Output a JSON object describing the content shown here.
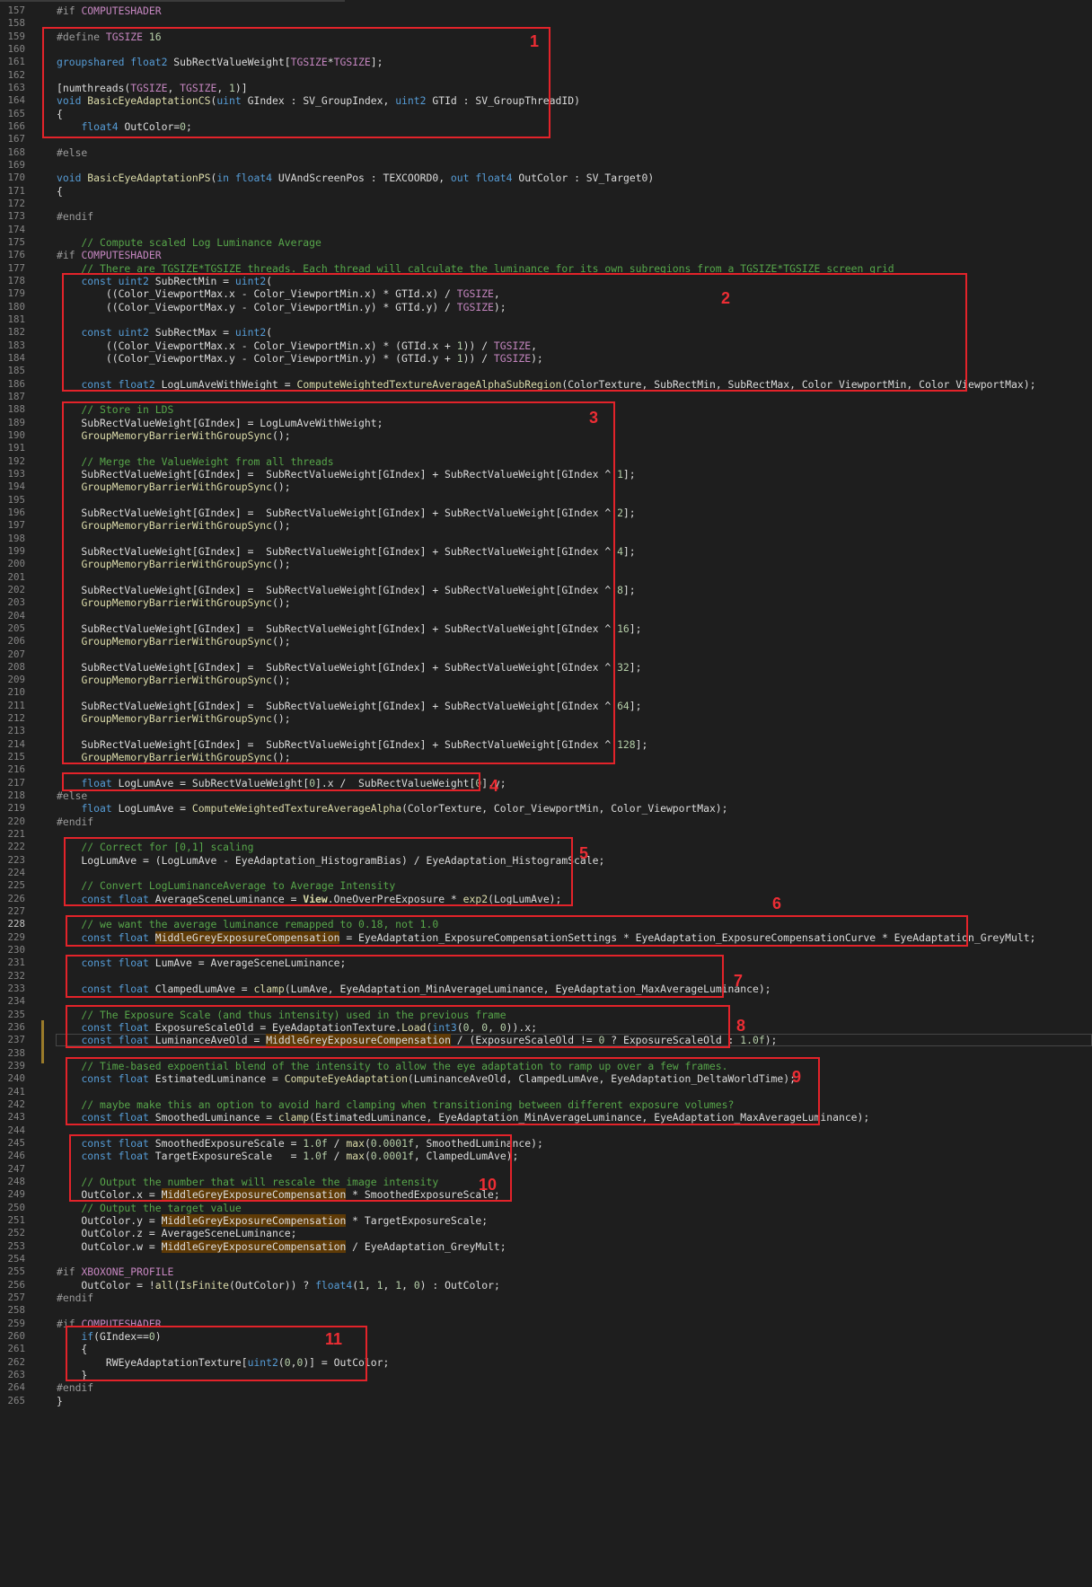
{
  "lines": [
    {
      "n": "157",
      "t": "#if COMPUTESHADER"
    },
    {
      "n": "158",
      "t": ""
    },
    {
      "n": "159",
      "t": "#define TGSIZE 16"
    },
    {
      "n": "160",
      "t": ""
    },
    {
      "n": "161",
      "t": "groupshared float2 SubRectValueWeight[TGSIZE*TGSIZE];"
    },
    {
      "n": "162",
      "t": ""
    },
    {
      "n": "163",
      "t": "[numthreads(TGSIZE, TGSIZE, 1)]"
    },
    {
      "n": "164",
      "t": "void BasicEyeAdaptationCS(uint GIndex : SV_GroupIndex, uint2 GTId : SV_GroupThreadID)"
    },
    {
      "n": "165",
      "t": "{"
    },
    {
      "n": "166",
      "t": "    float4 OutColor=0;"
    },
    {
      "n": "167",
      "t": ""
    },
    {
      "n": "168",
      "t": "#else"
    },
    {
      "n": "169",
      "t": ""
    },
    {
      "n": "170",
      "t": "void BasicEyeAdaptationPS(in float4 UVAndScreenPos : TEXCOORD0, out float4 OutColor : SV_Target0)"
    },
    {
      "n": "171",
      "t": "{"
    },
    {
      "n": "172",
      "t": ""
    },
    {
      "n": "173",
      "t": "#endif"
    },
    {
      "n": "174",
      "t": ""
    },
    {
      "n": "175",
      "t": "    // Compute scaled Log Luminance Average"
    },
    {
      "n": "176",
      "t": "#if COMPUTESHADER"
    },
    {
      "n": "177",
      "t": "    // There are TGSIZE*TGSIZE threads. Each thread will calculate the luminance for its own subregions from a TGSIZE*TGSIZE screen grid"
    },
    {
      "n": "178",
      "t": "    const uint2 SubRectMin = uint2("
    },
    {
      "n": "179",
      "t": "        ((Color_ViewportMax.x - Color_ViewportMin.x) * GTId.x) / TGSIZE,"
    },
    {
      "n": "180",
      "t": "        ((Color_ViewportMax.y - Color_ViewportMin.y) * GTId.y) / TGSIZE);"
    },
    {
      "n": "181",
      "t": ""
    },
    {
      "n": "182",
      "t": "    const uint2 SubRectMax = uint2("
    },
    {
      "n": "183",
      "t": "        ((Color_ViewportMax.x - Color_ViewportMin.x) * (GTId.x + 1)) / TGSIZE,"
    },
    {
      "n": "184",
      "t": "        ((Color_ViewportMax.y - Color_ViewportMin.y) * (GTId.y + 1)) / TGSIZE);"
    },
    {
      "n": "185",
      "t": ""
    },
    {
      "n": "186",
      "t": "    const float2 LogLumAveWithWeight = ComputeWeightedTextureAverageAlphaSubRegion(ColorTexture, SubRectMin, SubRectMax, Color_ViewportMin, Color_ViewportMax);"
    },
    {
      "n": "187",
      "t": ""
    },
    {
      "n": "188",
      "t": "    // Store in LDS"
    },
    {
      "n": "189",
      "t": "    SubRectValueWeight[GIndex] = LogLumAveWithWeight;"
    },
    {
      "n": "190",
      "t": "    GroupMemoryBarrierWithGroupSync();"
    },
    {
      "n": "191",
      "t": ""
    },
    {
      "n": "192",
      "t": "    // Merge the ValueWeight from all threads"
    },
    {
      "n": "193",
      "t": "    SubRectValueWeight[GIndex] =  SubRectValueWeight[GIndex] + SubRectValueWeight[GIndex ^ 1];"
    },
    {
      "n": "194",
      "t": "    GroupMemoryBarrierWithGroupSync();"
    },
    {
      "n": "195",
      "t": ""
    },
    {
      "n": "196",
      "t": "    SubRectValueWeight[GIndex] =  SubRectValueWeight[GIndex] + SubRectValueWeight[GIndex ^ 2];"
    },
    {
      "n": "197",
      "t": "    GroupMemoryBarrierWithGroupSync();"
    },
    {
      "n": "198",
      "t": ""
    },
    {
      "n": "199",
      "t": "    SubRectValueWeight[GIndex] =  SubRectValueWeight[GIndex] + SubRectValueWeight[GIndex ^ 4];"
    },
    {
      "n": "200",
      "t": "    GroupMemoryBarrierWithGroupSync();"
    },
    {
      "n": "201",
      "t": ""
    },
    {
      "n": "202",
      "t": "    SubRectValueWeight[GIndex] =  SubRectValueWeight[GIndex] + SubRectValueWeight[GIndex ^ 8];"
    },
    {
      "n": "203",
      "t": "    GroupMemoryBarrierWithGroupSync();"
    },
    {
      "n": "204",
      "t": ""
    },
    {
      "n": "205",
      "t": "    SubRectValueWeight[GIndex] =  SubRectValueWeight[GIndex] + SubRectValueWeight[GIndex ^ 16];"
    },
    {
      "n": "206",
      "t": "    GroupMemoryBarrierWithGroupSync();"
    },
    {
      "n": "207",
      "t": ""
    },
    {
      "n": "208",
      "t": "    SubRectValueWeight[GIndex] =  SubRectValueWeight[GIndex] + SubRectValueWeight[GIndex ^ 32];"
    },
    {
      "n": "209",
      "t": "    GroupMemoryBarrierWithGroupSync();"
    },
    {
      "n": "210",
      "t": ""
    },
    {
      "n": "211",
      "t": "    SubRectValueWeight[GIndex] =  SubRectValueWeight[GIndex] + SubRectValueWeight[GIndex ^ 64];"
    },
    {
      "n": "212",
      "t": "    GroupMemoryBarrierWithGroupSync();"
    },
    {
      "n": "213",
      "t": ""
    },
    {
      "n": "214",
      "t": "    SubRectValueWeight[GIndex] =  SubRectValueWeight[GIndex] + SubRectValueWeight[GIndex ^ 128];"
    },
    {
      "n": "215",
      "t": "    GroupMemoryBarrierWithGroupSync();"
    },
    {
      "n": "216",
      "t": ""
    },
    {
      "n": "217",
      "t": "    float LogLumAve = SubRectValueWeight[0].x /  SubRectValueWeight[0].y;"
    },
    {
      "n": "218",
      "t": "#else"
    },
    {
      "n": "219",
      "t": "    float LogLumAve = ComputeWeightedTextureAverageAlpha(ColorTexture, Color_ViewportMin, Color_ViewportMax);"
    },
    {
      "n": "220",
      "t": "#endif"
    },
    {
      "n": "221",
      "t": ""
    },
    {
      "n": "222",
      "t": "    // Correct for [0,1] scaling"
    },
    {
      "n": "223",
      "t": "    LogLumAve = (LogLumAve - EyeAdaptation_HistogramBias) / EyeAdaptation_HistogramScale;"
    },
    {
      "n": "224",
      "t": ""
    },
    {
      "n": "225",
      "t": "    // Convert LogLuminanceAverage to Average Intensity"
    },
    {
      "n": "226",
      "t": "    const float AverageSceneLuminance = View.OneOverPreExposure * exp2(LogLumAve);"
    },
    {
      "n": "227",
      "t": ""
    },
    {
      "n": "228",
      "t": "    // we want the average luminance remapped to 0.18, not 1.0"
    },
    {
      "n": "229",
      "t": "    const float MiddleGreyExposureCompensation = EyeAdaptation_ExposureCompensationSettings * EyeAdaptation_ExposureCompensationCurve * EyeAdaptation_GreyMult;"
    },
    {
      "n": "230",
      "t": ""
    },
    {
      "n": "231",
      "t": "    const float LumAve = AverageSceneLuminance;"
    },
    {
      "n": "232",
      "t": ""
    },
    {
      "n": "233",
      "t": "    const float ClampedLumAve = clamp(LumAve, EyeAdaptation_MinAverageLuminance, EyeAdaptation_MaxAverageLuminance);"
    },
    {
      "n": "234",
      "t": ""
    },
    {
      "n": "235",
      "t": "    // The Exposure Scale (and thus intensity) used in the previous frame"
    },
    {
      "n": "236",
      "t": "    const float ExposureScaleOld = EyeAdaptationTexture.Load(int3(0, 0, 0)).x;"
    },
    {
      "n": "237",
      "t": "    const float LuminanceAveOld = MiddleGreyExposureCompensation / (ExposureScaleOld != 0 ? ExposureScaleOld : 1.0f);"
    },
    {
      "n": "238",
      "t": ""
    },
    {
      "n": "239",
      "t": "    // Time-based expoential blend of the intensity to allow the eye adaptation to ramp up over a few frames."
    },
    {
      "n": "240",
      "t": "    const float EstimatedLuminance = ComputeEyeAdaptation(LuminanceAveOld, ClampedLumAve, EyeAdaptation_DeltaWorldTime);"
    },
    {
      "n": "241",
      "t": ""
    },
    {
      "n": "242",
      "t": "    // maybe make this an option to avoid hard clamping when transitioning between different exposure volumes?"
    },
    {
      "n": "243",
      "t": "    const float SmoothedLuminance = clamp(EstimatedLuminance, EyeAdaptation_MinAverageLuminance, EyeAdaptation_MaxAverageLuminance);"
    },
    {
      "n": "244",
      "t": ""
    },
    {
      "n": "245",
      "t": "    const float SmoothedExposureScale = 1.0f / max(0.0001f, SmoothedLuminance);"
    },
    {
      "n": "246",
      "t": "    const float TargetExposureScale   = 1.0f / max(0.0001f, ClampedLumAve);"
    },
    {
      "n": "247",
      "t": ""
    },
    {
      "n": "248",
      "t": "    // Output the number that will rescale the image intensity"
    },
    {
      "n": "249",
      "t": "    OutColor.x = MiddleGreyExposureCompensation * SmoothedExposureScale;"
    },
    {
      "n": "250",
      "t": "    // Output the target value"
    },
    {
      "n": "251",
      "t": "    OutColor.y = MiddleGreyExposureCompensation * TargetExposureScale;"
    },
    {
      "n": "252",
      "t": "    OutColor.z = AverageSceneLuminance;"
    },
    {
      "n": "253",
      "t": "    OutColor.w = MiddleGreyExposureCompensation / EyeAdaptation_GreyMult;"
    },
    {
      "n": "254",
      "t": ""
    },
    {
      "n": "255",
      "t": "#if XBOXONE_PROFILE"
    },
    {
      "n": "256",
      "t": "    OutColor = !all(IsFinite(OutColor)) ? float4(1, 1, 1, 0) : OutColor;"
    },
    {
      "n": "257",
      "t": "#endif"
    },
    {
      "n": "258",
      "t": ""
    },
    {
      "n": "259",
      "t": "#if COMPUTESHADER"
    },
    {
      "n": "260",
      "t": "    if(GIndex==0)"
    },
    {
      "n": "261",
      "t": "    {"
    },
    {
      "n": "262",
      "t": "        RWEyeAdaptationTexture[uint2(0,0)] = OutColor;"
    },
    {
      "n": "263",
      "t": "    }"
    },
    {
      "n": "264",
      "t": "#endif"
    },
    {
      "n": "265",
      "t": "}"
    }
  ],
  "annotations": [
    {
      "label": "1"
    },
    {
      "label": "2"
    },
    {
      "label": "3"
    },
    {
      "label": "4"
    },
    {
      "label": "5"
    },
    {
      "label": "6"
    },
    {
      "label": "7"
    },
    {
      "label": "8"
    },
    {
      "label": "9"
    },
    {
      "label": "10"
    },
    {
      "label": "11"
    }
  ],
  "colors": {
    "background": "#1e1e1e",
    "annotation": "#e3232a",
    "highlight": "#5e3a06"
  }
}
